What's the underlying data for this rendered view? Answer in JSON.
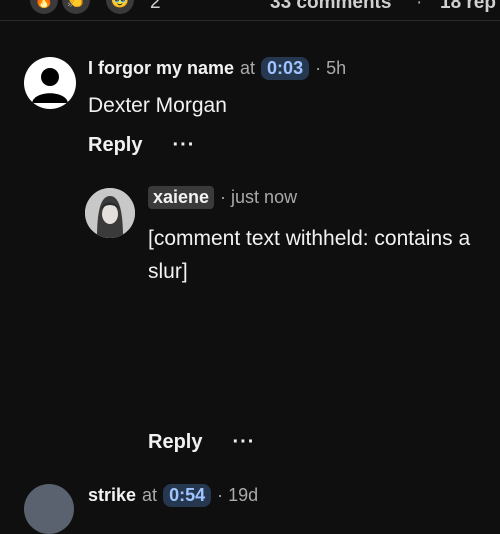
{
  "header": {
    "reactions": [
      "🔥",
      "👏",
      "🥹"
    ],
    "reaction_count": "2",
    "comments_count": "33 comments",
    "separator": "·",
    "replies_count": "18 rep"
  },
  "comments": [
    {
      "author": "I forgor my name",
      "at": "at",
      "timestamp": "0:03",
      "age": "· 5h",
      "text": "Dexter Morgan",
      "reply_label": "Reply",
      "more_label": "···"
    },
    {
      "author": "xaiene",
      "age": "· just now",
      "text": "[comment text withheld: contains a slur]",
      "reply_label": "Reply",
      "more_label": "···"
    },
    {
      "author": "strike",
      "at": "at",
      "timestamp": "0:54",
      "age": "· 19d"
    }
  ]
}
